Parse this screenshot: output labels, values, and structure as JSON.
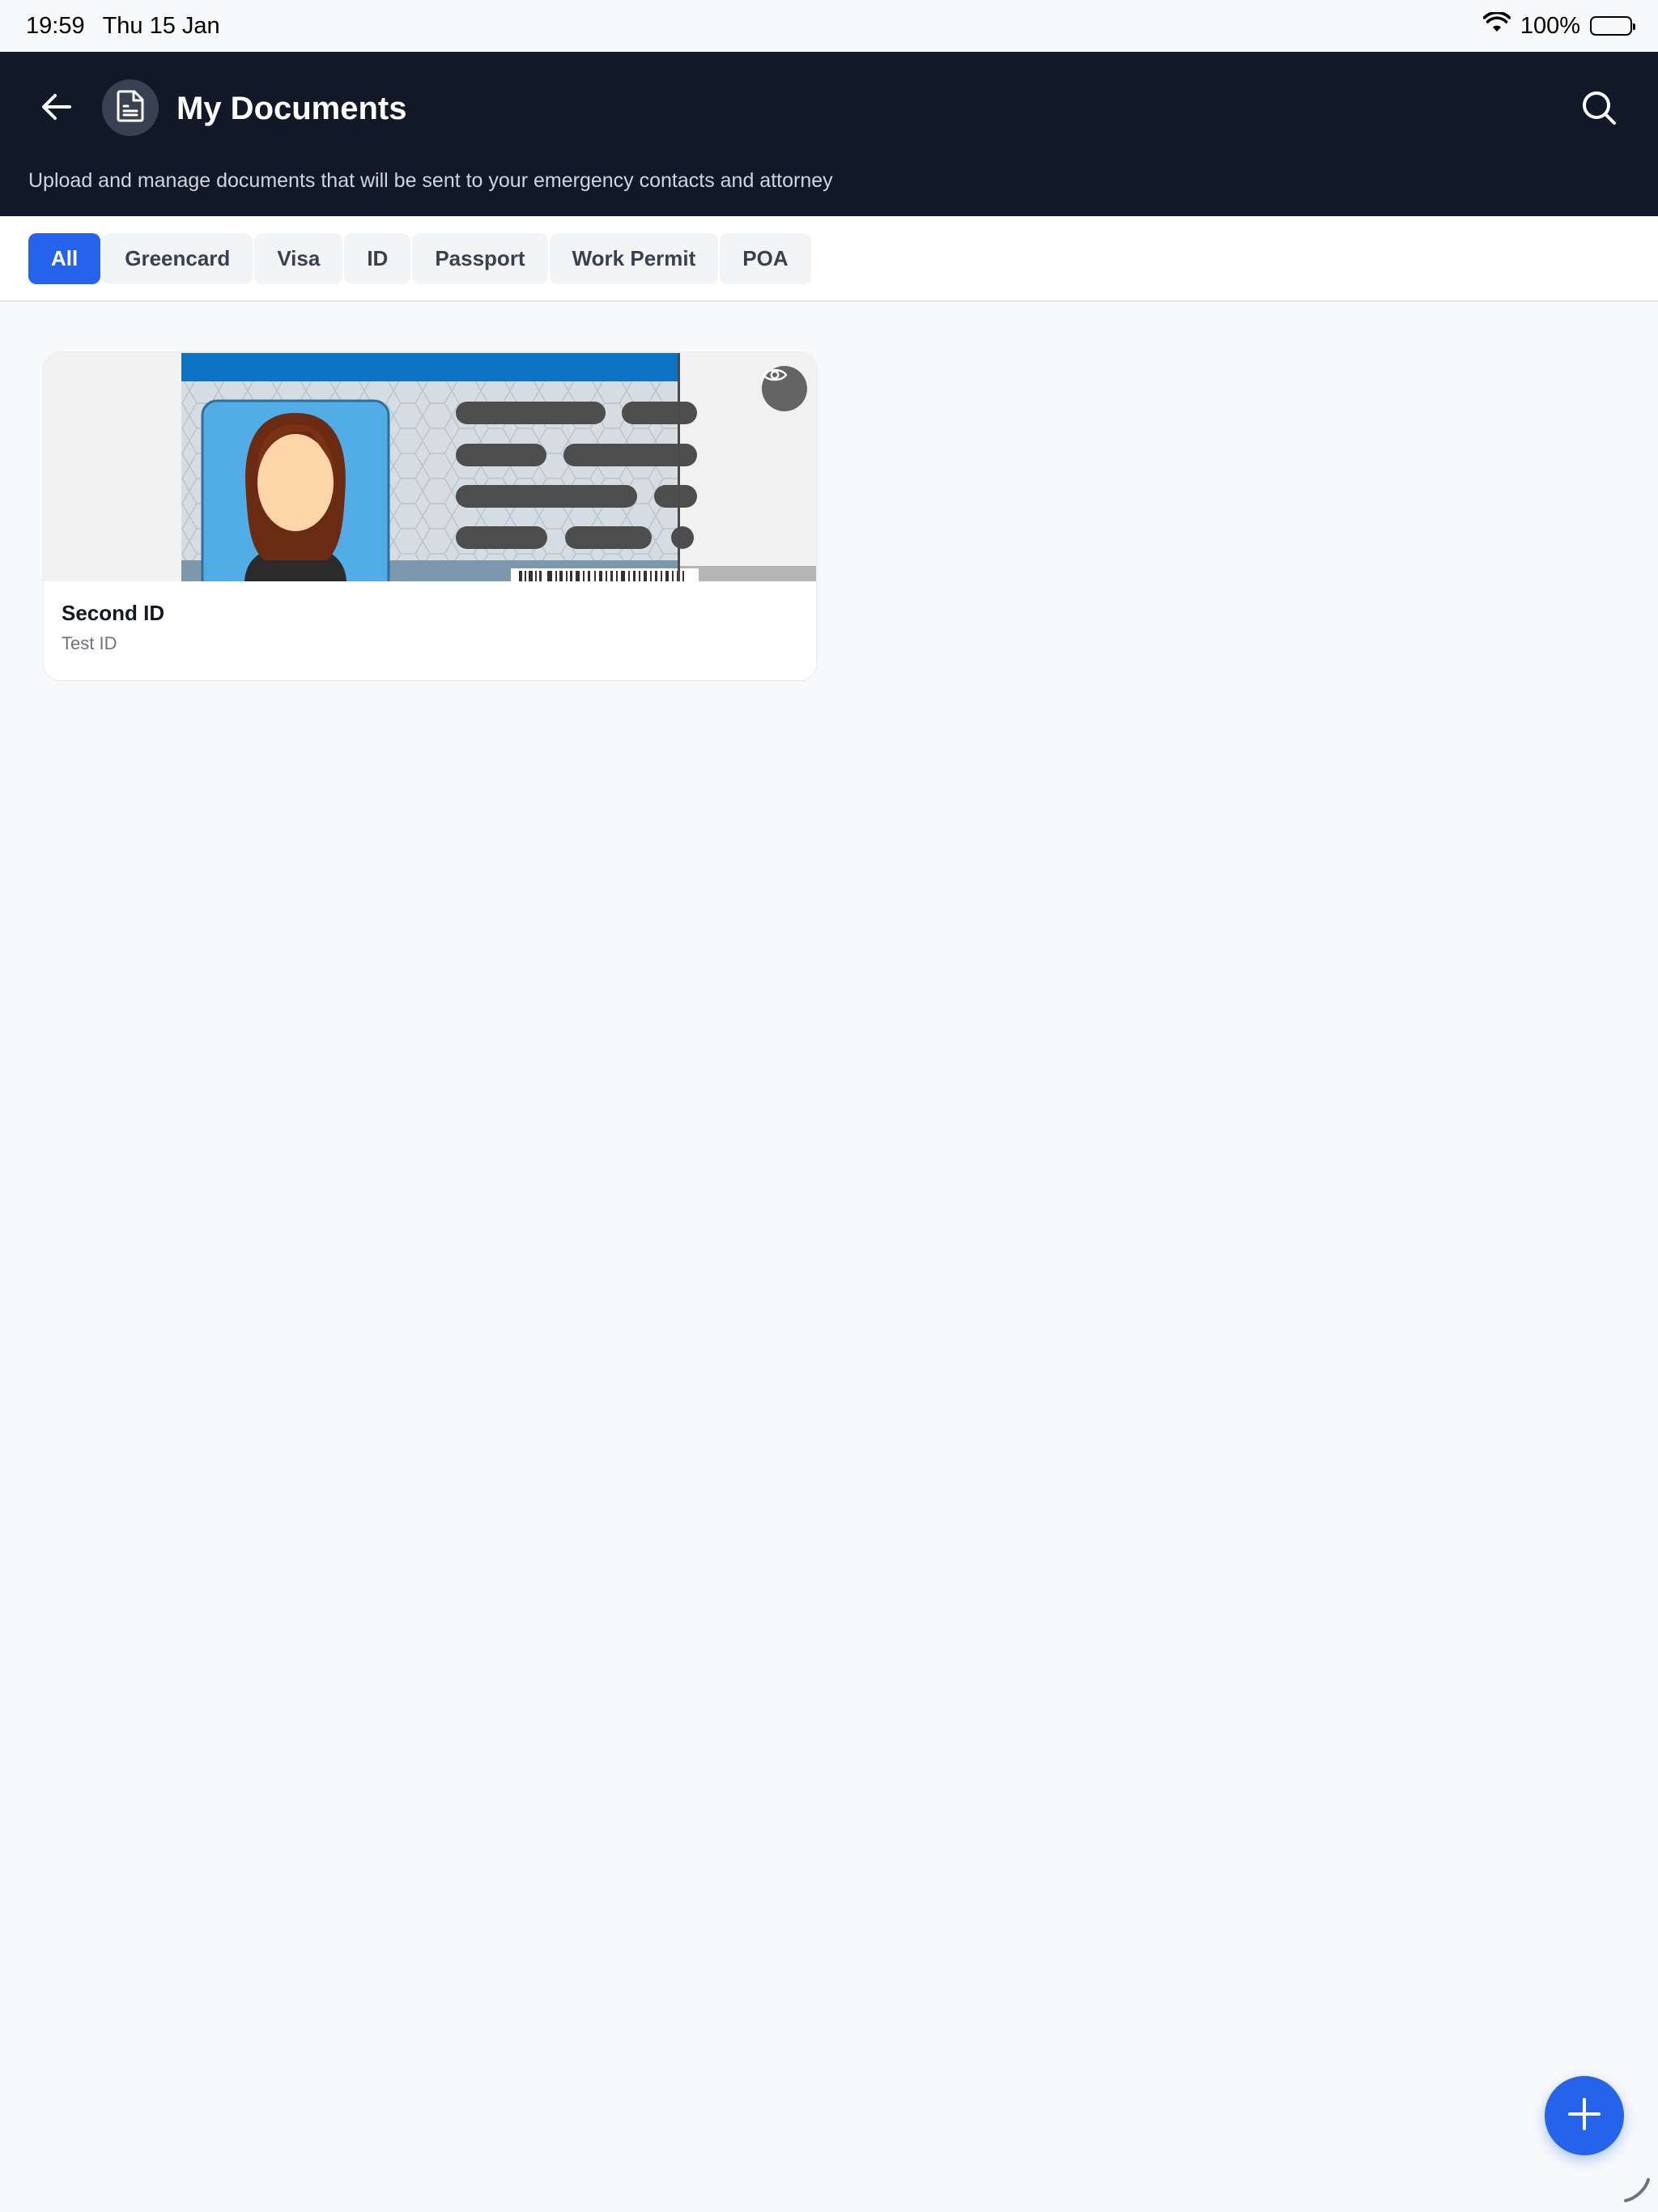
{
  "status_bar": {
    "time": "19:59",
    "date": "Thu 15 Jan",
    "battery": "100%",
    "icons": [
      "wifi-icon",
      "battery-icon"
    ]
  },
  "header": {
    "title": "My Documents",
    "subtitle": "Upload and manage documents that will be sent to your emergency contacts and attorney",
    "icons": [
      "back-arrow-icon",
      "document-icon",
      "search-icon"
    ]
  },
  "filters": {
    "active": "All",
    "items": [
      "All",
      "Greencard",
      "Visa",
      "ID",
      "Passport",
      "Work Permit",
      "POA"
    ]
  },
  "documents": [
    {
      "title": "Second ID",
      "subtitle": "Test ID",
      "thumbnail_icon": "id-card-image",
      "action_icon": "eye-icon"
    }
  ],
  "fab": {
    "icon": "plus-icon"
  },
  "colors": {
    "header_bg": "#111827",
    "accent": "#2563eb",
    "page_bg": "#f8f9fb"
  }
}
